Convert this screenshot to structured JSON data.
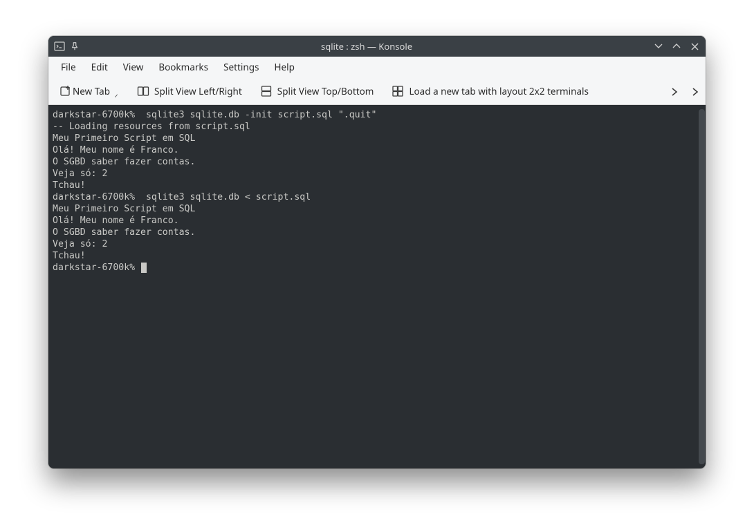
{
  "window": {
    "title": "sqlite : zsh — Konsole"
  },
  "menubar": {
    "file": "File",
    "edit": "Edit",
    "view": "View",
    "bookmarks": "Bookmarks",
    "settings": "Settings",
    "help": "Help"
  },
  "toolbar": {
    "new_tab": "New Tab",
    "split_lr": "Split View Left/Right",
    "split_tb": "Split View Top/Bottom",
    "load_layout": "Load a new tab with layout 2x2 terminals"
  },
  "terminal": {
    "lines": [
      "darkstar-6700k%  sqlite3 sqlite.db -init script.sql \".quit\"",
      "-- Loading resources from script.sql",
      "Meu Primeiro Script em SQL",
      "Olá! Meu nome é Franco.",
      "O SGBD saber fazer contas.",
      "Veja só: 2",
      "Tchau!",
      "darkstar-6700k%  sqlite3 sqlite.db < script.sql",
      "Meu Primeiro Script em SQL",
      "Olá! Meu nome é Franco.",
      "O SGBD saber fazer contas.",
      "Veja só: 2",
      "Tchau!"
    ],
    "prompt": "darkstar-6700k% "
  }
}
